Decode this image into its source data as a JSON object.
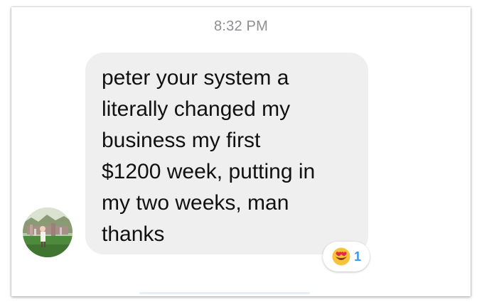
{
  "thread": {
    "timestamp": "8:32 PM"
  },
  "message": {
    "text": "peter  your system a\nliterally changed my\nbusiness  my first\n$1200 week, putting in\nmy two weeks, man\nthanks",
    "bubble_color": "#efefef",
    "text_color": "#111111"
  },
  "sender": {
    "avatar_icon": "profile-photo"
  },
  "reaction": {
    "emoji_icon": "heart-eyes-emoji",
    "count": "1",
    "count_color": "#3897f0"
  }
}
